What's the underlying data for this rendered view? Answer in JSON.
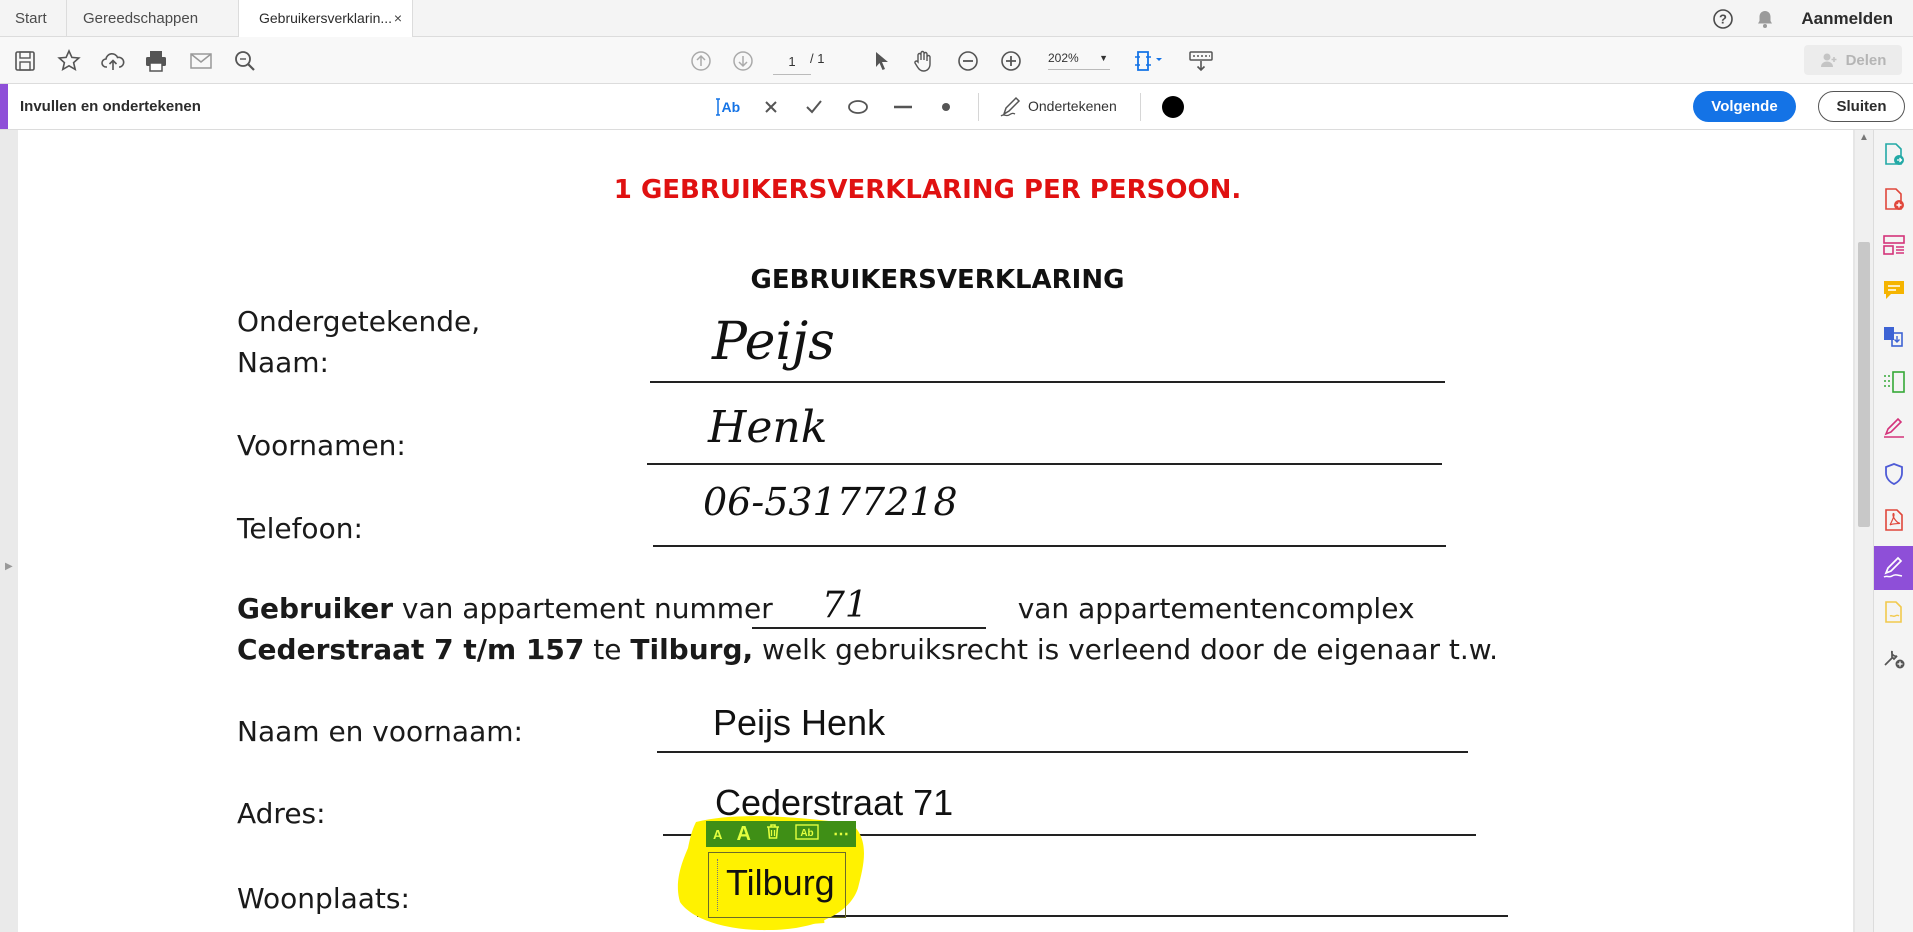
{
  "tabs": [
    {
      "label": "Start"
    },
    {
      "label": "Gereedschappen"
    },
    {
      "label": "Gebruikersverklarin...",
      "close": "×"
    }
  ],
  "header": {
    "login_label": "Aanmelden"
  },
  "toolbar": {
    "page_current": "1",
    "page_total": "/ 1",
    "zoom": "202%",
    "share_label": "Delen",
    "icons": [
      "save-icon",
      "bookmark-star-icon",
      "upload-cloud-icon",
      "print-icon",
      "email-icon",
      "search-zoom-icon",
      "arrow-up-circle-icon",
      "arrow-down-circle-icon",
      "select-pointer-icon",
      "hand-pan-icon",
      "zoom-out-icon",
      "zoom-in-icon",
      "fit-page-icon",
      "keyboard-scroll-icon"
    ]
  },
  "fill_sign": {
    "title": "Invullen en ondertekenen",
    "text_tool": "IAb",
    "sign_label": "Ondertekenen",
    "next_label": "Volgende",
    "close_label": "Sluiten",
    "color": "#000000",
    "accent": "#8e4fd8"
  },
  "document": {
    "red_heading": "1 GEBRUIKERSVERKLARING PER PERSOON.",
    "heading": "GEBRUIKERSVERKLARING",
    "label_ondergetekende": "Ondergetekende,",
    "label_naam": "Naam:",
    "label_voornamen": "Voornamen:",
    "label_telefoon": "Telefoon:",
    "para1": {
      "bold1": "Gebruiker",
      "text1": " van appartement nummer",
      "text2": " van appartementencomplex",
      "bold2": "Cederstraat 7 t/m 157",
      "text3": " te ",
      "bold3": "Tilburg,",
      "text4": " welk gebruiksrecht is verleend door de eigenaar t.w."
    },
    "label_naam_voornaam": "Naam en voornaam:",
    "label_adres": "Adres:",
    "label_woonplaats": "Woonplaats:",
    "hand_naam": "Peijs",
    "hand_voornamen": "Henk",
    "hand_telefoon": "06-53177218",
    "hand_nummer": "71",
    "typed_naam_voornaam": "Peijs Henk",
    "typed_adres": "Cederstraat 71",
    "typed_woonplaats": "Tilburg",
    "highlight_color": "#fff200",
    "editbar_color": "#3f8f16"
  },
  "rail_tools": [
    "export-pdf-icon",
    "create-pdf-icon",
    "organize-pages-icon",
    "comment-icon",
    "combine-files-icon",
    "edit-pdf-icon",
    "fill-sign-pen-icon",
    "protect-shield-icon",
    "pdf-acrobat-icon",
    "fill-sign-active-icon",
    "send-for-signature-icon",
    "more-tools-icon"
  ]
}
